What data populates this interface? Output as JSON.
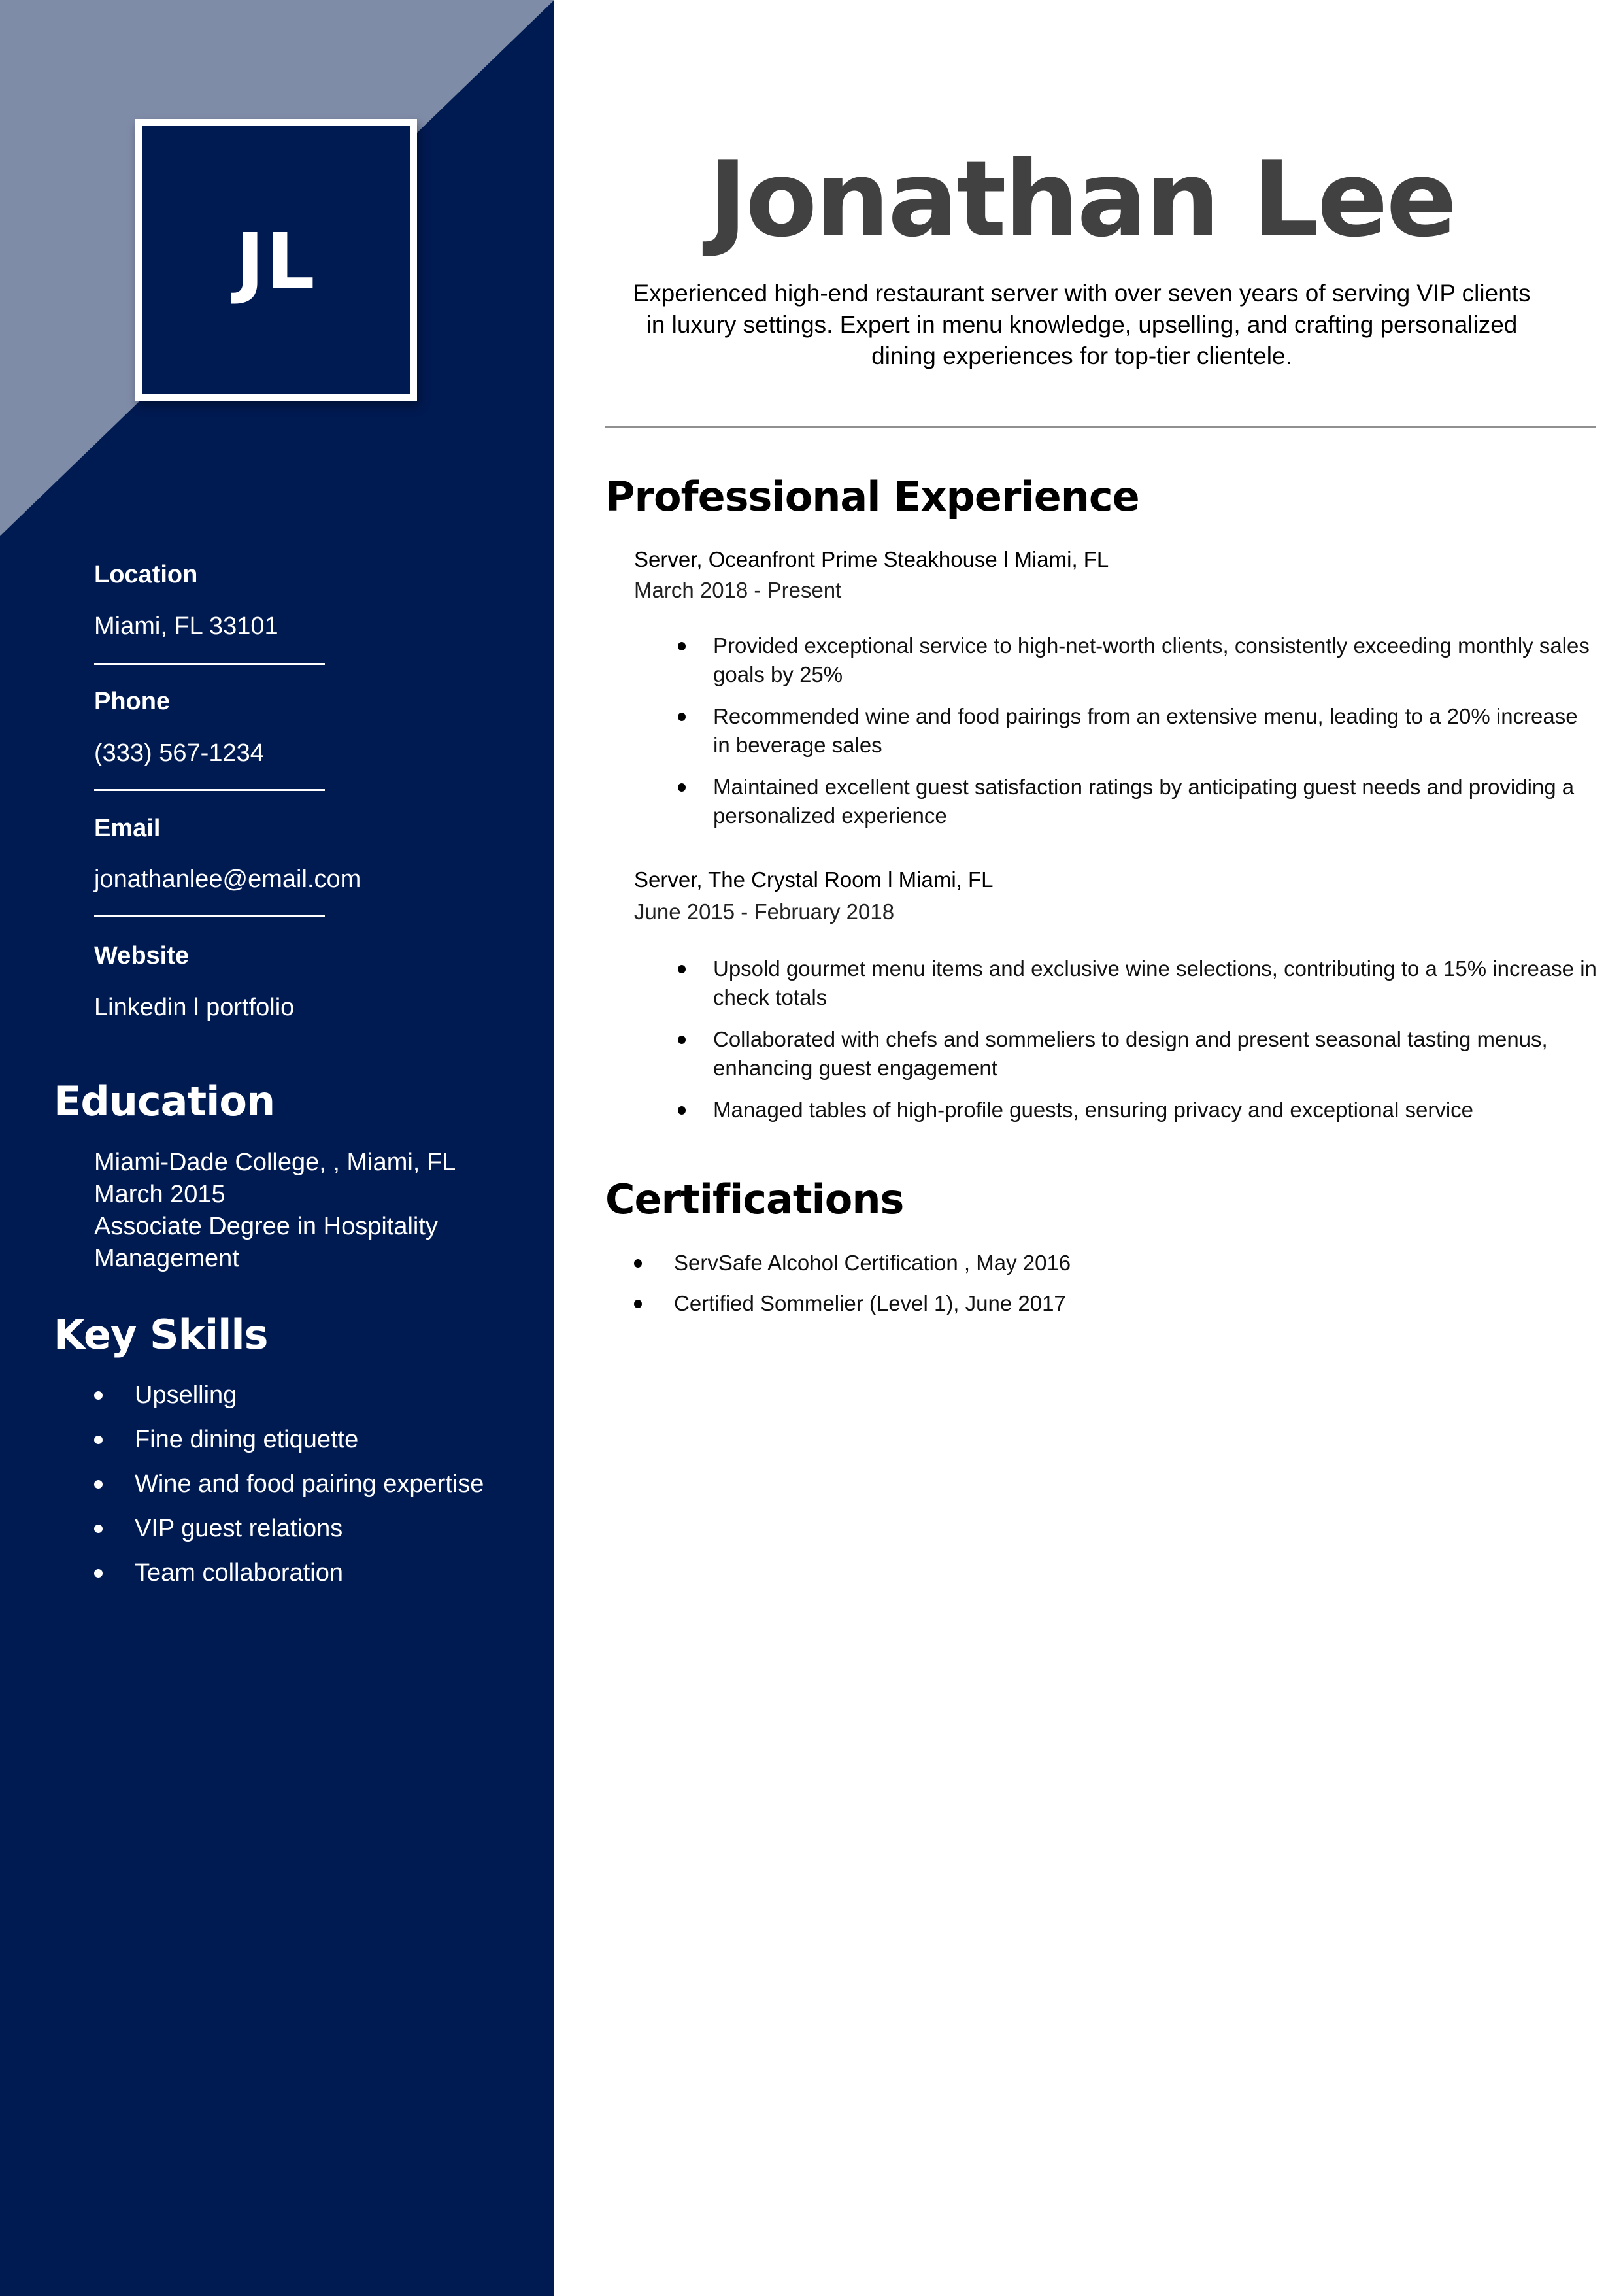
{
  "colors": {
    "sidebar": "#001a52",
    "sidebar_accent": "#7f8ca8",
    "name": "#414141",
    "divider": "#909090"
  },
  "monogram": "JL",
  "name": "Jonathan Lee",
  "summary": "Experienced high-end restaurant server with over seven years of serving VIP clients in luxury settings. Expert in menu knowledge, upselling, and crafting personalized dining experiences for top-tier clientele.",
  "contact": [
    {
      "label": "Location",
      "value": "Miami, FL 33101"
    },
    {
      "label": "Phone",
      "value": "(333) 567-1234"
    },
    {
      "label": "Email",
      "value": "jonathanlee@email.com"
    },
    {
      "label": "Website",
      "value": "Linkedin l portfolio"
    }
  ],
  "education": {
    "heading": "Education",
    "lines": [
      "Miami-Dade College, , Miami, FL",
      "March 2015",
      "Associate Degree in Hospitality",
      "Management"
    ]
  },
  "skills": {
    "heading": "Key Skills",
    "items": [
      "Upselling",
      "Fine dining etiquette",
      "Wine and food pairing expertise",
      "VIP guest relations",
      "Team collaboration"
    ]
  },
  "experience": {
    "heading": "Professional Experience",
    "jobs": [
      {
        "title": "Server, Oceanfront Prime Steakhouse l Miami, FL",
        "dates": "March 2018 - Present",
        "bullets": [
          "Provided exceptional service to high-net-worth clients, consistently exceeding monthly sales goals by 25%",
          "Recommended wine and food pairings from an extensive menu, leading to a 20% increase in beverage sales",
          "Maintained excellent guest satisfaction ratings by anticipating guest needs and providing a personalized experience"
        ]
      },
      {
        "title": "Server, The Crystal Room l Miami, FL",
        "dates": "June 2015 - February 2018",
        "bullets": [
          "Upsold gourmet menu items and exclusive wine selections, contributing to a 15% increase in check totals",
          "Collaborated with chefs and sommeliers to design and present seasonal tasting menus, enhancing guest engagement",
          "Managed tables of high-profile guests, ensuring privacy and exceptional service"
        ]
      }
    ]
  },
  "certifications": {
    "heading": "Certifications",
    "items": [
      "ServSafe Alcohol Certification , May 2016",
      "Certified Sommelier (Level 1), June 2017"
    ]
  }
}
